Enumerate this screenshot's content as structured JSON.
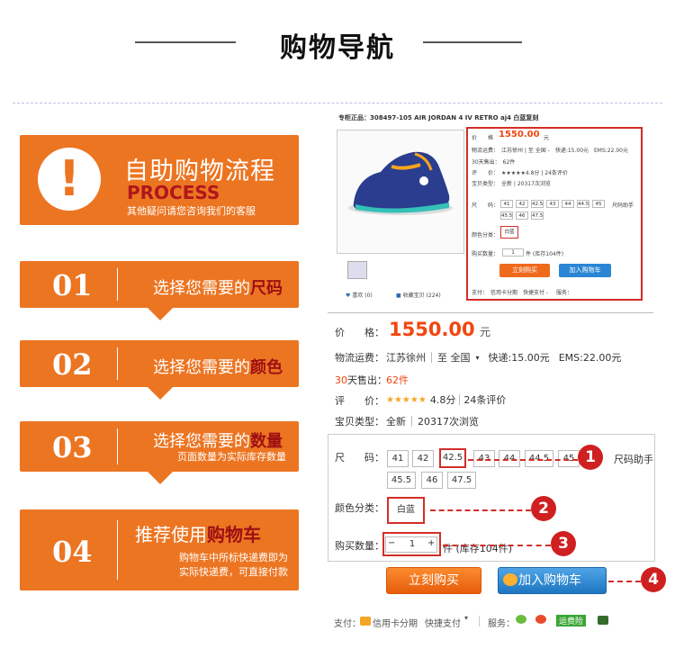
{
  "header": {
    "title": "购物导航"
  },
  "intro": {
    "icon": "exclamation-icon",
    "title": "自助购物流程",
    "subtitle_en": "PROCESS",
    "note": "其他疑问请您咨询我们的客服"
  },
  "steps": [
    {
      "num": "01",
      "prefix": "选择您需要的",
      "highlight": "尺码",
      "note": ""
    },
    {
      "num": "02",
      "prefix": "选择您需要的",
      "highlight": "颜色",
      "note": ""
    },
    {
      "num": "03",
      "prefix": "选择您需要的",
      "highlight": "数量",
      "note": "页面数量为实际库存数量"
    },
    {
      "num": "04",
      "prefix": "推荐使用",
      "highlight": "购物车",
      "note_lines": [
        "购物车中所标快递费即为",
        "实际快递费，可直接付款"
      ]
    }
  ],
  "thumb": {
    "title": "专柜正品：308497-105 AIR JORDAN 4 IV RETRO aj4 白蓝复刻",
    "price_label": "价　　格",
    "price": "1550.00",
    "yuan": "元",
    "shipping": "物流运费：　江苏徐州 | 至 全国 -　快递:15.00元　EMS:22.00元",
    "sold": "30天售出：　62件",
    "rating": "评　　价：　★★★★★4.8分 | 24条评价",
    "type": "宝贝类型：　全新 | 20317次浏览",
    "size_label": "尺　　码：",
    "sizes": [
      "41",
      "42",
      "42.5",
      "43",
      "44",
      "44.5",
      "45"
    ],
    "sizes2": [
      "45.5",
      "46",
      "47.5"
    ],
    "size_help": "尺码助手",
    "color_label": "颜色分类：",
    "color": "白蓝",
    "qty_label": "购买数量：",
    "qty": "1",
    "stock": "件 (库存104件)",
    "buy": "立刻购买",
    "cart": "加入购物车",
    "fav": "喜欢",
    "collect": "收藏宝贝",
    "fav_count": "(0)",
    "collect_count": "(224)",
    "pay": "支付：　信用卡分期　快捷支付 -",
    "service": "服务："
  },
  "detail": {
    "price_label": "价　　格：",
    "price": "1550.00",
    "yuan": "元",
    "ship_label": "物流运费：",
    "ship_from": "江苏徐州",
    "ship_to": "至 全国",
    "ship_express": "快递:15.00元",
    "ship_ems": "EMS:22.00元",
    "sold_days": "30",
    "sold_label": "天售出：",
    "sold_count": "62件",
    "rate_label": "评　　价：",
    "stars": "★★★★★",
    "rate_score": "4.8分",
    "rate_count": "24条评价",
    "type_label": "宝贝类型：",
    "type_val": "全新",
    "views": "20317次浏览",
    "size_label": "尺　　码：",
    "sizes_row1": [
      "41",
      "42",
      "42.5",
      "43",
      "44",
      "44.5",
      "45"
    ],
    "sizes_row2": [
      "45.5",
      "46",
      "47.5"
    ],
    "size_help": "尺码助手",
    "color_label": "颜色分类：",
    "color": "白蓝",
    "qty_label": "购买数量：",
    "qty": "1",
    "stock": "件 (库存104件)",
    "buy": "立刻购买",
    "cart": "加入购物车",
    "pay_label": "支付：",
    "pay_installment": "信用卡分期",
    "pay_quick": "快捷支付",
    "service_label": "服务：",
    "service_badge": "运费险"
  },
  "callouts": [
    "1",
    "2",
    "3",
    "4"
  ],
  "colors": {
    "orange": "#ec7522",
    "red": "#d32d28",
    "price": "#f2460f",
    "blue": "#1f76c2"
  }
}
